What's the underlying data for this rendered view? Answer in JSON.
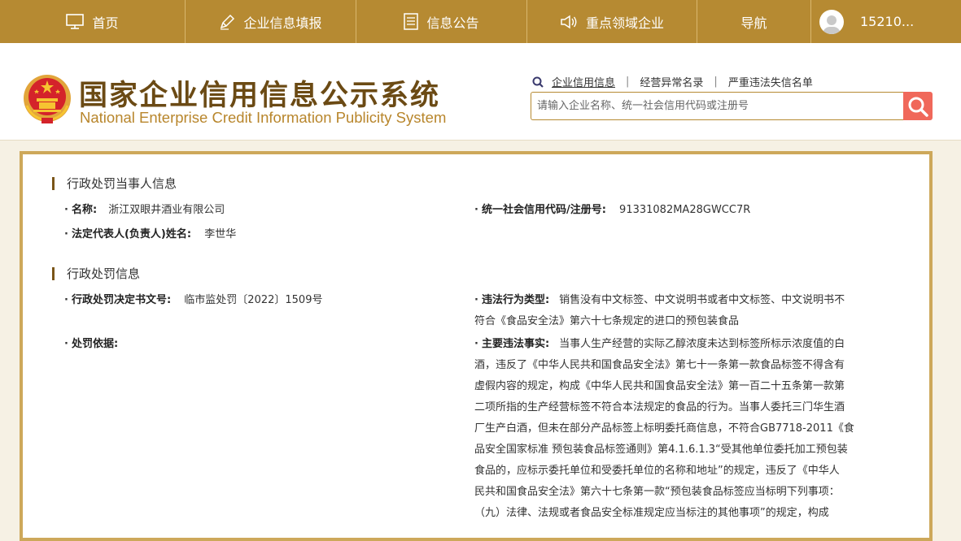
{
  "nav": {
    "home": "首页",
    "report": "企业信息填报",
    "notice": "信息公告",
    "key_enterprises": "重点领域企业",
    "guide": "导航",
    "user": "15210..."
  },
  "header": {
    "title_cn": "国家企业信用信息公示系统",
    "title_en": "National Enterprise Credit Information Publicity System",
    "search_tabs": [
      "企业信用信息",
      "经营异常名录",
      "严重违法失信名单"
    ],
    "search_placeholder": "请输入企业名称、统一社会信用代码或注册号"
  },
  "party_section": {
    "title": "行政处罚当事人信息",
    "name_label": "名称:",
    "name_value": "浙江双眼井酒业有限公司",
    "code_label": "统一社会信用代码/注册号:",
    "code_value": "91331082MA28GWCC7R",
    "rep_label": "法定代表人(负责人)姓名:",
    "rep_value": "李世华"
  },
  "penalty_section": {
    "title": "行政处罚信息",
    "doc_label": "行政处罚决定书文号:",
    "doc_value": "临市监处罚〔2022〕1509号",
    "type_label": "违法行为类型:",
    "type_lines": [
      "销售没有中文标签、中文说明书或者中文标签、中文说明书不",
      "符合《食品安全法》第六十七条规定的进口的预包装食品"
    ],
    "basis_label": "处罚依据:",
    "facts_label": "主要违法事实:",
    "facts_lines": [
      "当事人生产经营的实际乙醇浓度未达到标签所标示浓度值的白",
      "酒，违反了《中华人民共和国食品安全法》第七十一条第一款食品标签不得含有",
      "虚假内容的规定，构成《中华人民共和国食品安全法》第一百二十五条第一款第",
      "二项所指的生产经营标签不符合本法规定的食品的行为。当事人委托三门华生酒",
      "厂生产白酒，但未在部分产品标签上标明委托商信息，不符合GB7718-2011《食",
      "品安全国家标准 预包装食品标签通则》第4.1.6.1.3“受其他单位委托加工预包装",
      "食品的，应标示委托单位和受委托单位的名称和地址”的规定，违反了《中华人",
      "民共和国食品安全法》第六十七条第一款“预包装食品标签应当标明下列事项：",
      "（九）法律、法规或者食品安全标准规定应当标注的其他事项”的规定，构成"
    ]
  }
}
